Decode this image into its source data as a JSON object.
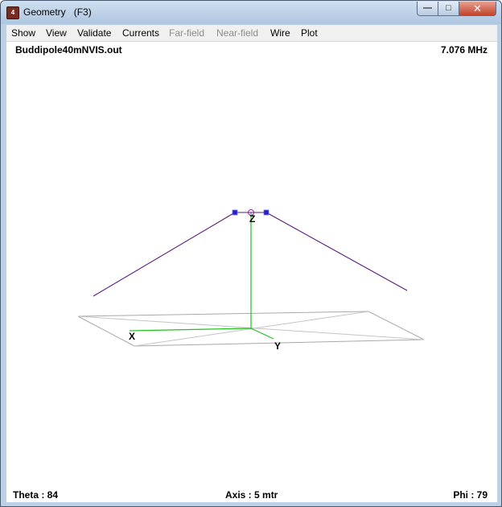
{
  "window": {
    "title": "Geometry",
    "shortcut": "(F3)",
    "minimize_glyph": "—",
    "maximize_glyph": "□",
    "close_glyph": "✕"
  },
  "menu": {
    "items": [
      "Show",
      "View",
      "Validate",
      "Currents",
      "Far-field",
      "Near-field",
      "Wire",
      "Plot"
    ],
    "disabled": [
      "Far-field",
      "Near-field"
    ]
  },
  "view": {
    "filename": "Buddipole40mNVIS.out",
    "frequency": "7.076 MHz",
    "theta": "Theta : 84",
    "axis": "Axis : 5 mtr",
    "phi": "Phi : 79",
    "axis_labels": {
      "x": "X",
      "y": "Y",
      "z": "Z"
    }
  },
  "colors": {
    "wire": "#5a1a7a",
    "axes": "#22c022",
    "ground": "#a8a8a8",
    "segment_marker": "#2222cc",
    "source_marker": "#8a2a9a"
  }
}
